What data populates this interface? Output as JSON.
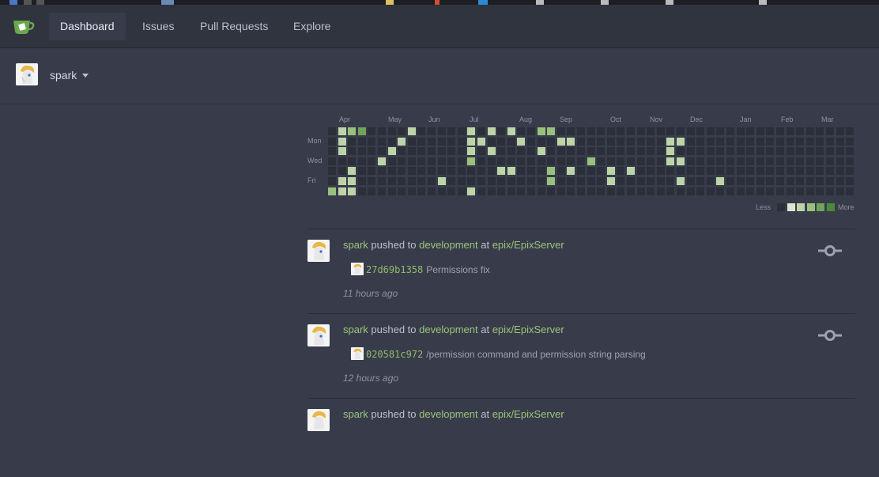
{
  "nav": {
    "items": [
      {
        "label": "Dashboard",
        "active": true
      },
      {
        "label": "Issues"
      },
      {
        "label": "Pull Requests"
      },
      {
        "label": "Explore"
      }
    ]
  },
  "context": {
    "name": "spark"
  },
  "heatmap": {
    "months": [
      "Apr",
      "May",
      "Jun",
      "Jul",
      "Aug",
      "Sep",
      "Oct",
      "Nov",
      "Dec",
      "Jan",
      "Feb",
      "Mar"
    ],
    "weekdays": [
      "Mon",
      "Wed",
      "Fri"
    ],
    "legend_less": "Less",
    "legend_more": "More",
    "colors": [
      "#2b2f3a",
      "#dce7d2",
      "#bcd4a8",
      "#99c07c",
      "#6fa45a",
      "#4b8a3a"
    ],
    "weeks": [
      [
        0,
        0,
        0,
        0,
        0,
        0,
        3
      ],
      [
        2,
        2,
        2,
        0,
        0,
        2,
        2
      ],
      [
        3,
        0,
        0,
        0,
        2,
        2,
        2
      ],
      [
        4,
        0,
        0,
        0,
        0,
        0,
        0
      ],
      [
        0,
        0,
        0,
        0,
        0,
        0,
        0
      ],
      [
        0,
        0,
        0,
        2,
        0,
        0,
        0
      ],
      [
        0,
        0,
        2,
        0,
        0,
        0,
        0
      ],
      [
        0,
        2,
        0,
        0,
        0,
        0,
        0
      ],
      [
        2,
        0,
        0,
        0,
        0,
        0,
        0
      ],
      [
        0,
        0,
        0,
        0,
        0,
        0,
        0
      ],
      [
        0,
        0,
        0,
        0,
        0,
        0,
        0
      ],
      [
        0,
        0,
        0,
        0,
        0,
        2,
        0
      ],
      [
        0,
        0,
        0,
        0,
        0,
        0,
        0
      ],
      [
        0,
        0,
        0,
        0,
        0,
        0,
        0
      ],
      [
        2,
        2,
        2,
        3,
        0,
        0,
        2
      ],
      [
        0,
        2,
        0,
        0,
        0,
        0,
        0
      ],
      [
        2,
        0,
        2,
        0,
        0,
        0,
        0
      ],
      [
        0,
        0,
        0,
        0,
        2,
        0,
        0
      ],
      [
        2,
        0,
        0,
        0,
        2,
        0,
        0
      ],
      [
        0,
        2,
        0,
        0,
        0,
        0,
        0
      ],
      [
        0,
        0,
        0,
        0,
        0,
        0,
        0
      ],
      [
        3,
        0,
        2,
        0,
        0,
        0,
        0
      ],
      [
        3,
        0,
        0,
        0,
        3,
        3,
        0
      ],
      [
        0,
        2,
        0,
        0,
        0,
        0,
        0
      ],
      [
        0,
        2,
        0,
        0,
        2,
        0,
        0
      ],
      [
        0,
        0,
        0,
        0,
        0,
        0,
        0
      ],
      [
        0,
        0,
        0,
        3,
        0,
        0,
        0
      ],
      [
        0,
        0,
        0,
        0,
        0,
        0,
        0
      ],
      [
        0,
        0,
        0,
        0,
        2,
        2,
        0
      ],
      [
        0,
        0,
        0,
        0,
        0,
        0,
        0
      ],
      [
        0,
        0,
        0,
        0,
        2,
        0,
        0
      ],
      [
        0,
        0,
        0,
        0,
        0,
        0,
        0
      ],
      [
        0,
        0,
        0,
        0,
        0,
        0,
        0
      ],
      [
        0,
        0,
        0,
        0,
        0,
        0,
        0
      ],
      [
        0,
        2,
        2,
        2,
        0,
        0,
        0
      ],
      [
        0,
        2,
        0,
        2,
        0,
        2,
        0
      ],
      [
        0,
        0,
        0,
        0,
        0,
        0,
        0
      ],
      [
        0,
        0,
        0,
        0,
        0,
        0,
        0
      ],
      [
        0,
        0,
        0,
        0,
        0,
        0,
        0
      ],
      [
        0,
        0,
        0,
        0,
        0,
        2,
        0
      ],
      [
        0,
        0,
        0,
        0,
        0,
        0,
        0
      ],
      [
        0,
        0,
        0,
        0,
        0,
        0,
        0
      ],
      [
        0,
        0,
        0,
        0,
        0,
        0,
        0
      ],
      [
        0,
        0,
        0,
        0,
        0,
        0,
        0
      ],
      [
        0,
        0,
        0,
        0,
        0,
        0,
        0
      ],
      [
        0,
        0,
        0,
        0,
        0,
        0,
        0
      ],
      [
        0,
        0,
        0,
        0,
        0,
        0,
        0
      ],
      [
        0,
        0,
        0,
        0,
        0,
        0,
        0
      ],
      [
        0,
        0,
        0,
        0,
        0,
        0,
        0
      ],
      [
        0,
        0,
        0,
        0,
        0,
        0,
        0
      ],
      [
        0,
        0,
        0,
        0,
        0,
        0,
        0
      ],
      [
        0,
        0,
        0,
        0,
        0,
        0,
        0
      ],
      [
        0,
        0,
        0,
        0,
        0,
        0,
        0
      ]
    ]
  },
  "feed": [
    {
      "user": "spark",
      "action": "pushed to",
      "branch": "development",
      "at": "at",
      "repo": "epix/EpixServer",
      "sha": "27d69b1358",
      "message": "Permissions fix",
      "time": "11 hours ago"
    },
    {
      "user": "spark",
      "action": "pushed to",
      "branch": "development",
      "at": "at",
      "repo": "epix/EpixServer",
      "sha": "020581c972",
      "message": "/permission command and permission string parsing",
      "time": "12 hours ago"
    },
    {
      "user": "spark",
      "action": "pushed to",
      "branch": "development",
      "at": "at",
      "repo": "epix/EpixServer"
    }
  ]
}
